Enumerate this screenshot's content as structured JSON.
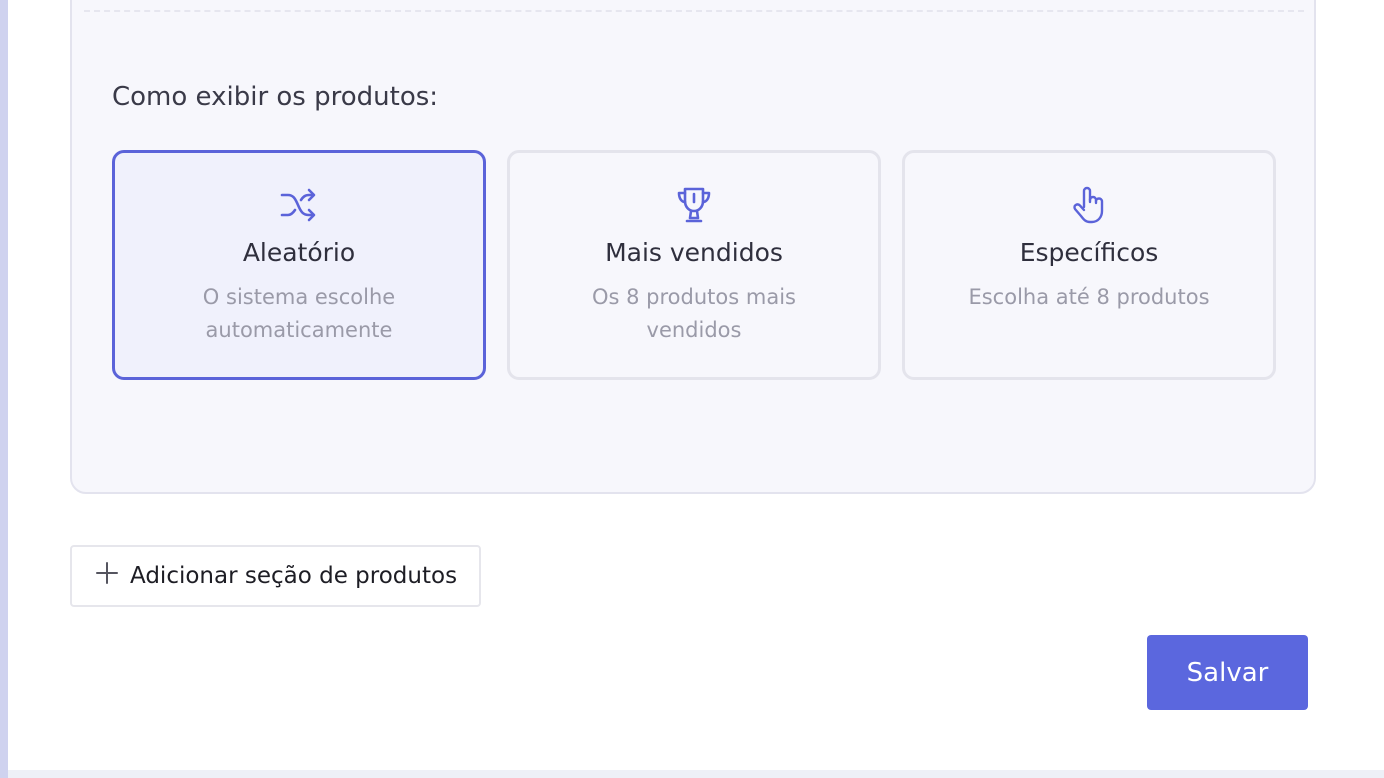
{
  "display": {
    "label": "Como exibir os produtos:",
    "options": [
      {
        "icon": "shuffle-icon",
        "title": "Aleatório",
        "description": "O sistema escolhe automaticamente",
        "selected": true
      },
      {
        "icon": "trophy-icon",
        "title": "Mais vendidos",
        "description": "Os 8 produtos mais vendidos",
        "selected": false
      },
      {
        "icon": "pointer-hand-icon",
        "title": "Específicos",
        "description": "Escolha até 8 produtos",
        "selected": false
      }
    ]
  },
  "actions": {
    "add_section_label": "Adicionar seção de produtos",
    "save_label": "Salvar"
  },
  "colors": {
    "accent": "#5b63d9",
    "save_button": "#5b67de"
  }
}
